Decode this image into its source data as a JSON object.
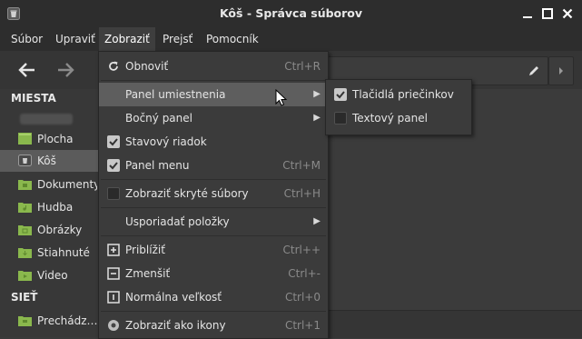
{
  "window": {
    "title": "Kôš - Správca súborov"
  },
  "menubar": {
    "items": [
      {
        "label": "Súbor"
      },
      {
        "label": "Upraviť"
      },
      {
        "label": "Zobraziť"
      },
      {
        "label": "Prejsť"
      },
      {
        "label": "Pomocník"
      }
    ]
  },
  "sidebar": {
    "places_header": "MIESTA",
    "places": [
      {
        "label": "Plocha",
        "icon": "desktop-folder-icon"
      },
      {
        "label": "Kôš",
        "icon": "trash-icon",
        "selected": true
      },
      {
        "label": "Dokumenty",
        "icon": "documents-folder-icon"
      },
      {
        "label": "Hudba",
        "icon": "music-folder-icon"
      },
      {
        "label": "Obrázky",
        "icon": "pictures-folder-icon"
      },
      {
        "label": "Stiahnuté",
        "icon": "downloads-folder-icon"
      },
      {
        "label": "Video",
        "icon": "videos-folder-icon"
      }
    ],
    "network_header": "SIEŤ",
    "network": [
      {
        "label": "Prechádz…",
        "icon": "network-folder-icon"
      }
    ]
  },
  "view_menu": {
    "items": [
      {
        "label": "Obnoviť",
        "shortcut": "Ctrl+R",
        "icon": "refresh-icon"
      },
      {
        "label": "Panel umiestnenia",
        "submenu": true,
        "highlighted": true
      },
      {
        "label": "Bočný panel",
        "submenu": true
      },
      {
        "label": "Stavový riadok",
        "checked": true
      },
      {
        "label": "Panel menu",
        "shortcut": "Ctrl+M",
        "checked": true
      },
      {
        "label": "Zobraziť skryté súbory",
        "shortcut": "Ctrl+H",
        "checked": false
      },
      {
        "label": "Usporiadať položky",
        "submenu": true
      },
      {
        "label": "Priblížiť",
        "shortcut": "Ctrl++",
        "icon": "zoom-in-icon"
      },
      {
        "label": "Zmenšiť",
        "shortcut": "Ctrl+-",
        "icon": "zoom-out-icon"
      },
      {
        "label": "Normálna veľkosť",
        "shortcut": "Ctrl+0",
        "icon": "zoom-normal-icon"
      },
      {
        "label": "Zobraziť ako ikony",
        "shortcut": "Ctrl+1",
        "radio": true
      }
    ]
  },
  "location_submenu": {
    "items": [
      {
        "label": "Tlačidlá priečinkov",
        "checked": true
      },
      {
        "label": "Textový panel",
        "checked": false
      }
    ]
  },
  "colors": {
    "titlebar": "#2d2d2d",
    "menu_bg": "#3b3b3b",
    "highlight": "#5e5e5e",
    "folder_green": "#8ab84d"
  }
}
